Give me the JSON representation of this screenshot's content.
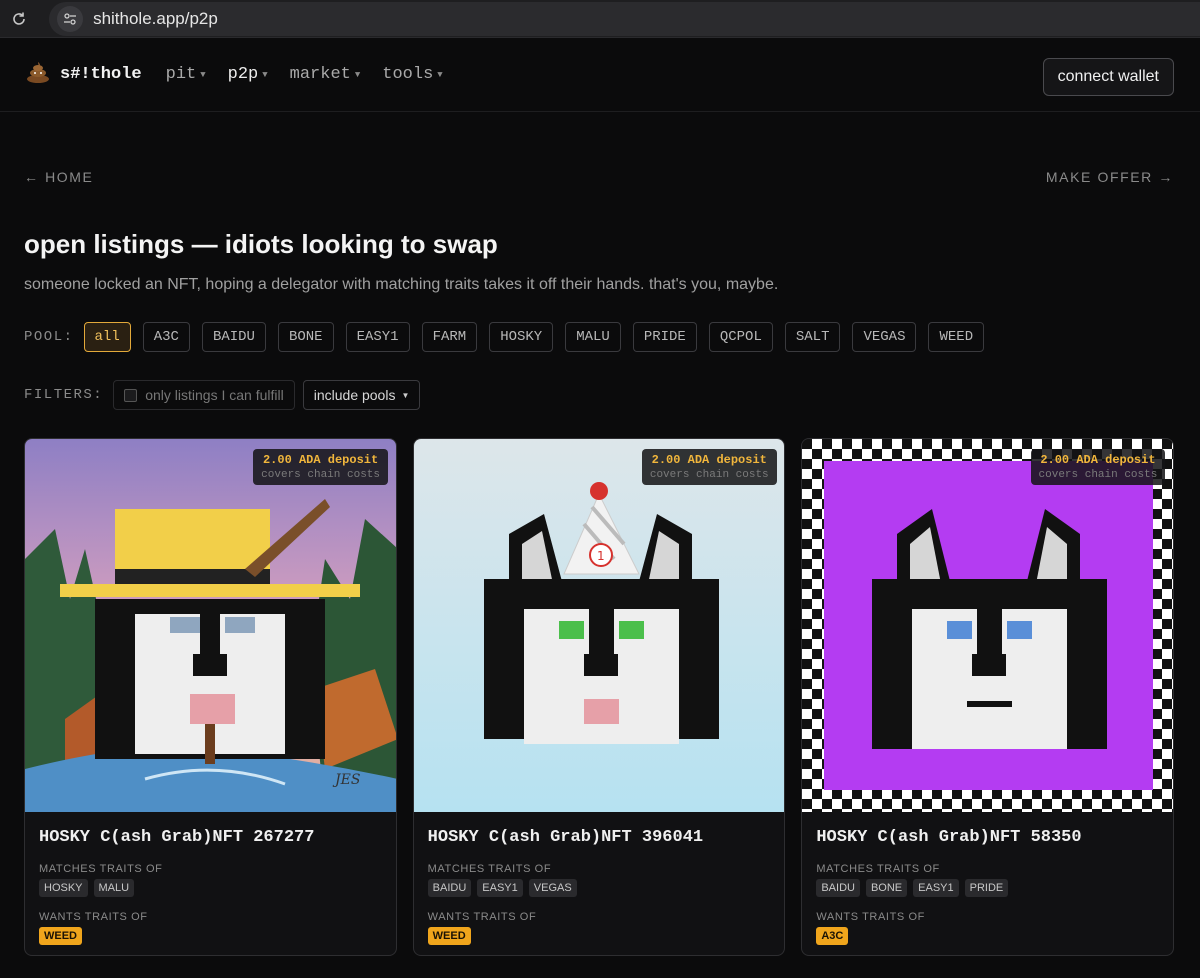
{
  "browser": {
    "url": "shithole.app/p2p"
  },
  "nav": {
    "brand": "s#!thole",
    "items": [
      {
        "label": "pit",
        "active": false
      },
      {
        "label": "p2p",
        "active": true
      },
      {
        "label": "market",
        "active": false
      },
      {
        "label": "tools",
        "active": false
      }
    ],
    "connect_label": "connect wallet"
  },
  "page": {
    "back_link": "← HOME",
    "offer_link": "MAKE OFFER →",
    "title": "open listings — idiots looking to swap",
    "subtitle": "someone locked an NFT, hoping a delegator with matching traits takes it off their hands. that's you, maybe."
  },
  "pool": {
    "label": "POOL:",
    "options": [
      "all",
      "A3C",
      "BAIDU",
      "BONE",
      "EASY1",
      "FARM",
      "HOSKY",
      "MALU",
      "PRIDE",
      "QCPOL",
      "SALT",
      "VEGAS",
      "WEED"
    ],
    "selected": "all"
  },
  "filters": {
    "label": "FILTERS:",
    "checkbox_label": "only listings I can fulfill",
    "checkbox_checked": false,
    "select_label": "include pools"
  },
  "listings": [
    {
      "name": "HOSKY C(ash Grab)NFT 267277",
      "deposit": "2.00 ADA deposit",
      "deposit_note": "covers chain costs",
      "matches_label": "MATCHES TRAITS OF",
      "matches": [
        "HOSKY",
        "MALU"
      ],
      "wants_label": "WANTS TRAITS OF",
      "wants": [
        "WEED"
      ],
      "art_signature": "JES"
    },
    {
      "name": "HOSKY C(ash Grab)NFT 396041",
      "deposit": "2.00 ADA deposit",
      "deposit_note": "covers chain costs",
      "matches_label": "MATCHES TRAITS OF",
      "matches": [
        "BAIDU",
        "EASY1",
        "VEGAS"
      ],
      "wants_label": "WANTS TRAITS OF",
      "wants": [
        "WEED"
      ],
      "art_badge": "1"
    },
    {
      "name": "HOSKY C(ash Grab)NFT 58350",
      "deposit": "2.00 ADA deposit",
      "deposit_note": "covers chain costs",
      "matches_label": "MATCHES TRAITS OF",
      "matches": [
        "BAIDU",
        "BONE",
        "EASY1",
        "PRIDE"
      ],
      "wants_label": "WANTS TRAITS OF",
      "wants": [
        "A3C"
      ]
    }
  ],
  "colors": {
    "accent": "#f0a51c",
    "background": "#0b0b0c",
    "purple_bg": "#b43cf2",
    "sky_bg": "#bde6f2"
  }
}
